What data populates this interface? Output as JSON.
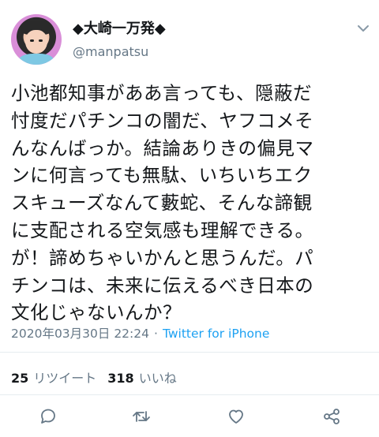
{
  "user": {
    "display_name": "◆大崎一万発◆",
    "handle": "@manpatsu"
  },
  "tweet": {
    "text": "小池都知事がああ言っても、隠蔽だ\n忖度だパチンコの闇だ、ヤフコメそ\nんなんばっか。結論ありきの偏見マ\nンに何言っても無駄、いちいちエク\nスキューズなんて藪蛇、そんな諦観\nに支配される空気感も理解できる。\nが！諦めちゃいかんと思うんだ。パ\nチンコは、未来に伝えるべき日本の\n文化じゃないんか？",
    "timestamp": "2020年03月30日 22:24",
    "separator": "·",
    "source": "Twitter for iPhone"
  },
  "stats": {
    "retweets_count": "25",
    "retweets_label": "リツイート",
    "likes_count": "318",
    "likes_label": "いいね"
  },
  "icons": {
    "menu": "chevron-down-icon",
    "reply": "reply-icon",
    "retweet": "retweet-icon",
    "like": "heart-icon",
    "share": "share-icon"
  },
  "colors": {
    "text": "#14171a",
    "secondary": "#657786",
    "link": "#1da1f2",
    "divider": "#e6ecf0"
  }
}
